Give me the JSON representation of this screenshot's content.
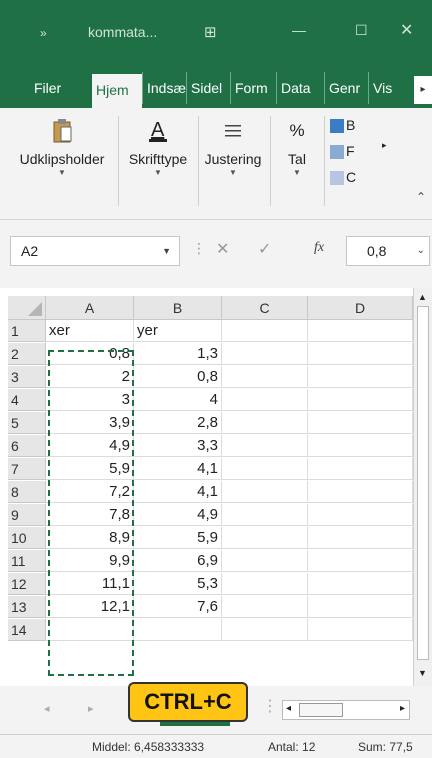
{
  "window": {
    "title": "kommata...",
    "quick_access": "»"
  },
  "ribbon_tabs": [
    "Filer",
    "Hjem",
    "Indsæ",
    "Sidel",
    "Form",
    "Data",
    "Genr",
    "Vis"
  ],
  "ribbon_groups": {
    "clipboard": "Udklipsholder",
    "font": "Skrifttype",
    "alignment": "Justering",
    "number": "Tal",
    "styles": [
      "B",
      "F",
      "C"
    ]
  },
  "formula_bar": {
    "name_box": "A2",
    "fx": "fx",
    "value": "0,8"
  },
  "columns": [
    "A",
    "B",
    "C",
    "D"
  ],
  "rows": [
    {
      "n": "1",
      "a": "xer",
      "b": "yer"
    },
    {
      "n": "2",
      "a": "0,8",
      "b": "1,3"
    },
    {
      "n": "3",
      "a": "2",
      "b": "0,8"
    },
    {
      "n": "4",
      "a": "3",
      "b": "4"
    },
    {
      "n": "5",
      "a": "3,9",
      "b": "2,8"
    },
    {
      "n": "6",
      "a": "4,9",
      "b": "3,3"
    },
    {
      "n": "7",
      "a": "5,9",
      "b": "4,1"
    },
    {
      "n": "8",
      "a": "7,2",
      "b": "4,1"
    },
    {
      "n": "9",
      "a": "7,8",
      "b": "4,9"
    },
    {
      "n": "10",
      "a": "8,9",
      "b": "5,9"
    },
    {
      "n": "11",
      "a": "9,9",
      "b": "6,9"
    },
    {
      "n": "12",
      "a": "11,1",
      "b": "5,3"
    },
    {
      "n": "13",
      "a": "12,1",
      "b": "7,6"
    },
    {
      "n": "14",
      "a": "",
      "b": ""
    }
  ],
  "callout": "CTRL+C",
  "status": {
    "average": "Middel: 6,458333333",
    "count": "Antal: 12",
    "sum": "Sum: 77,5"
  }
}
